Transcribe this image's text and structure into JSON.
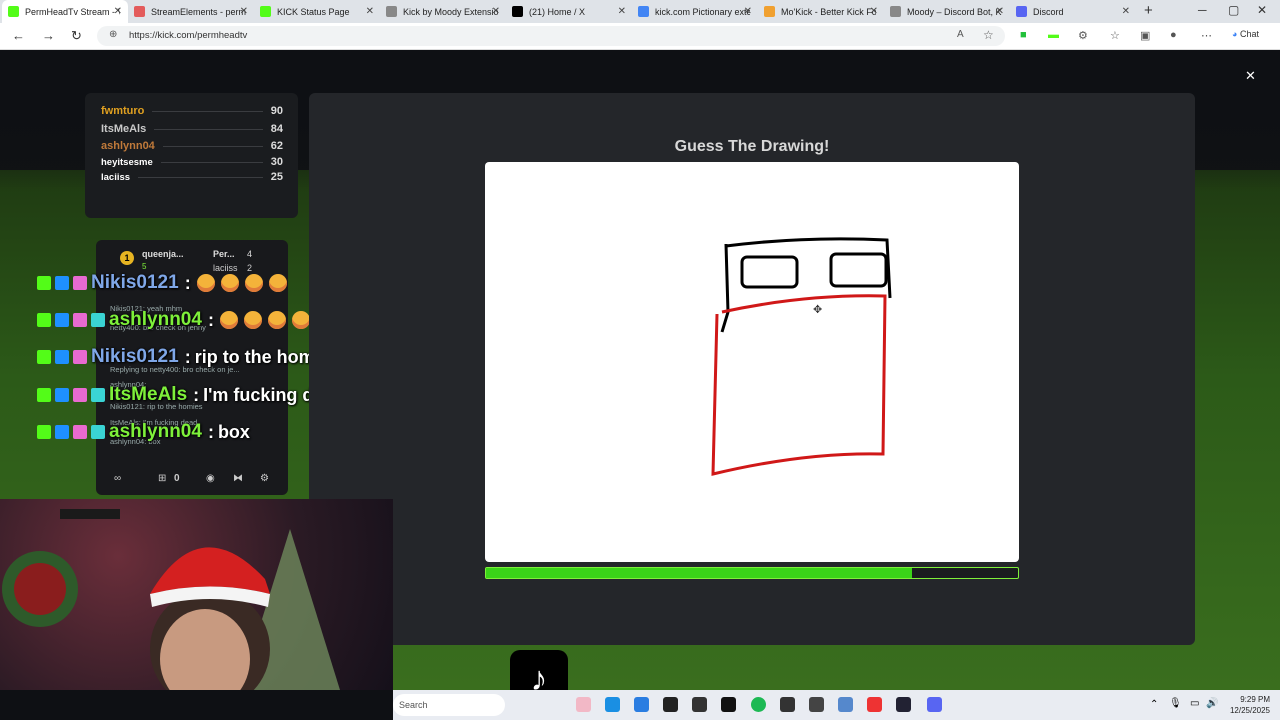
{
  "browser": {
    "tabs": [
      {
        "title": "PermHeadTv Stream - V",
        "color": "#53fc18",
        "active": true
      },
      {
        "title": "StreamElements - perm",
        "color": "#e35b5b",
        "active": false
      },
      {
        "title": "KICK Status Page",
        "color": "#53fc18",
        "active": false
      },
      {
        "title": "Kick by Moody Extensio",
        "color": "#888888",
        "active": false
      },
      {
        "title": "(21) Home / X",
        "color": "#000000",
        "active": false
      },
      {
        "title": "kick.com Pictionary exte",
        "color": "#4285f4",
        "active": false
      },
      {
        "title": "Mo'Kick - Better Kick Fo",
        "color": "#f0a030",
        "active": false
      },
      {
        "title": "Moody – Discord Bot, K",
        "color": "#888888",
        "active": false
      },
      {
        "title": "Discord",
        "color": "#5865f2",
        "active": false
      }
    ],
    "url": "https://kick.com/permheadtv",
    "chat_button": "Chat"
  },
  "leaderboard": [
    {
      "name": "fwmturo",
      "score": "90",
      "color": "#e0a020"
    },
    {
      "name": "ItsMeAls",
      "score": "84",
      "color": "#c9c9c9"
    },
    {
      "name": "ashlynn04",
      "score": "62",
      "color": "#c07a3a"
    },
    {
      "name": "heyitsesme",
      "score": "30",
      "color": "#ffffff"
    },
    {
      "name": "laciiss",
      "score": "25",
      "color": "#ffffff"
    }
  ],
  "chat_card": {
    "top_left": "queenja...",
    "top_left_sub": "5",
    "top_right": "Per...",
    "top_right_count": "4",
    "second_right": "laciiss",
    "second_right_count": "2",
    "lines": [
      "Nikis0121: yeah mhm",
      "netty400: bro check on jenny",
      "Replying to netty400: bro check on je...",
      "ashlynn04:",
      "Nikis0121: rip to the homies",
      "ItsMeAls: I'm fucking dead",
      "ashlynn04: box"
    ],
    "footer_count": "0"
  },
  "overlay_chat": [
    {
      "user": "Nikis0121",
      "sep": ":",
      "msg": "",
      "color": "#7fa7e8",
      "emotes": 4
    },
    {
      "user": "ashlynn04",
      "sep": ":",
      "msg": "",
      "color": "#7ef03a",
      "emotes": 4
    },
    {
      "user": "Nikis0121",
      "sep": ":",
      "msg": "rip to the homies",
      "color": "#7fa7e8",
      "emotes": 0
    },
    {
      "user": "ItsMeAls",
      "sep": ":",
      "msg": "I'm fucking dead",
      "color": "#7ef03a",
      "emotes": 0
    },
    {
      "user": "ashlynn04",
      "sep": ":",
      "msg": "box",
      "color": "#7ef03a",
      "emotes": 0
    }
  ],
  "game": {
    "title": "Guess The Drawing!",
    "progress": 0.8
  },
  "taskbar": {
    "search_placeholder": "Search",
    "time": "9:29 PM",
    "date": "12/25/2025"
  },
  "colors": {
    "kick_green": "#53fc18",
    "panel": "#24262a"
  }
}
